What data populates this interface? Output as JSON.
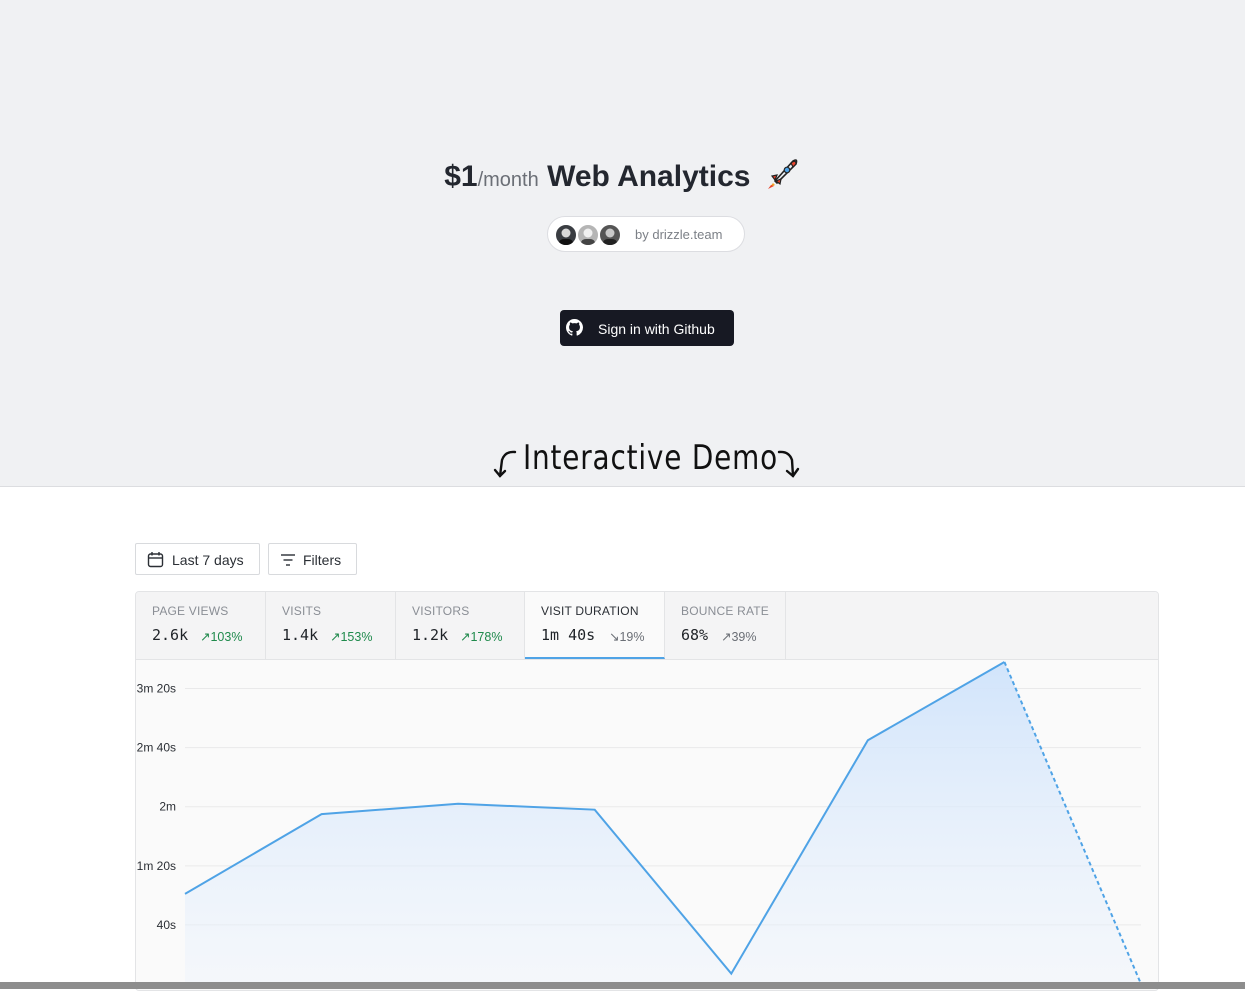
{
  "hero": {
    "price": "$1",
    "price_unit": "/month",
    "title": "Web Analytics",
    "by_text": "by drizzle.team",
    "signin_label": "Sign in with Github",
    "demo_label": "Interactive Demo"
  },
  "toolbar": {
    "date_range_label": "Last 7 days",
    "filters_label": "Filters"
  },
  "stats": [
    {
      "label": "PAGE VIEWS",
      "value": "2.6k",
      "delta": "103%",
      "direction": "up"
    },
    {
      "label": "VISITS",
      "value": "1.4k",
      "delta": "153%",
      "direction": "up"
    },
    {
      "label": "VISITORS",
      "value": "1.2k",
      "delta": "178%",
      "direction": "up"
    },
    {
      "label": "VISIT DURATION",
      "value": "1m 40s",
      "delta": "19%",
      "direction": "down",
      "active": true
    },
    {
      "label": "BOUNCE RATE",
      "value": "68%",
      "delta": "39%",
      "direction": "up"
    }
  ],
  "colors": {
    "accent": "#4fa3e6",
    "positive": "#1f8a4c",
    "neutral": "#6b6f76",
    "button_dark": "#171923"
  },
  "chart_data": {
    "type": "area",
    "ylabel": "",
    "yticks": [
      "40s",
      "1m 20s",
      "2m",
      "2m 40s",
      "3m 20s"
    ],
    "ytick_values": [
      40,
      80,
      120,
      160,
      200
    ],
    "ylim": [
      0,
      220
    ],
    "grid": true,
    "series": [
      {
        "values": [
          61,
          115,
          122,
          118,
          7,
          165,
          218,
          0
        ],
        "projected_last": true
      }
    ]
  }
}
